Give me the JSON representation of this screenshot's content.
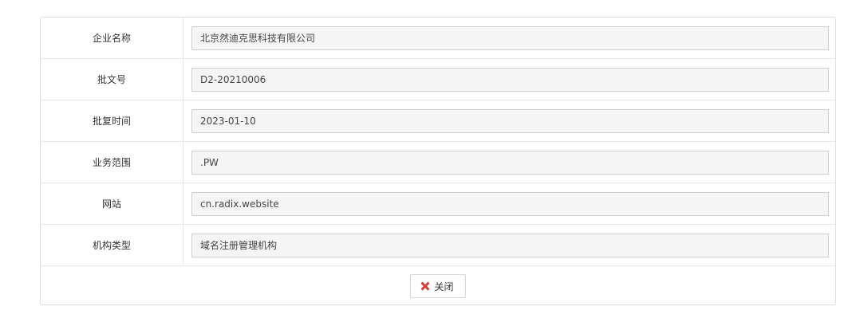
{
  "form": {
    "rows": [
      {
        "label": "企业名称",
        "value": "北京然迪克思科技有限公司"
      },
      {
        "label": "批文号",
        "value": "D2-20210006"
      },
      {
        "label": "批复时间",
        "value": "2023-01-10"
      },
      {
        "label": "业务范围",
        "value": ".PW"
      },
      {
        "label": "网站",
        "value": "cn.radix.website"
      },
      {
        "label": "机构类型",
        "value": "域名注册管理机构"
      }
    ]
  },
  "footer": {
    "close_label": "关闭",
    "close_icon": "close-x-icon",
    "close_icon_color": "#e0413a"
  }
}
